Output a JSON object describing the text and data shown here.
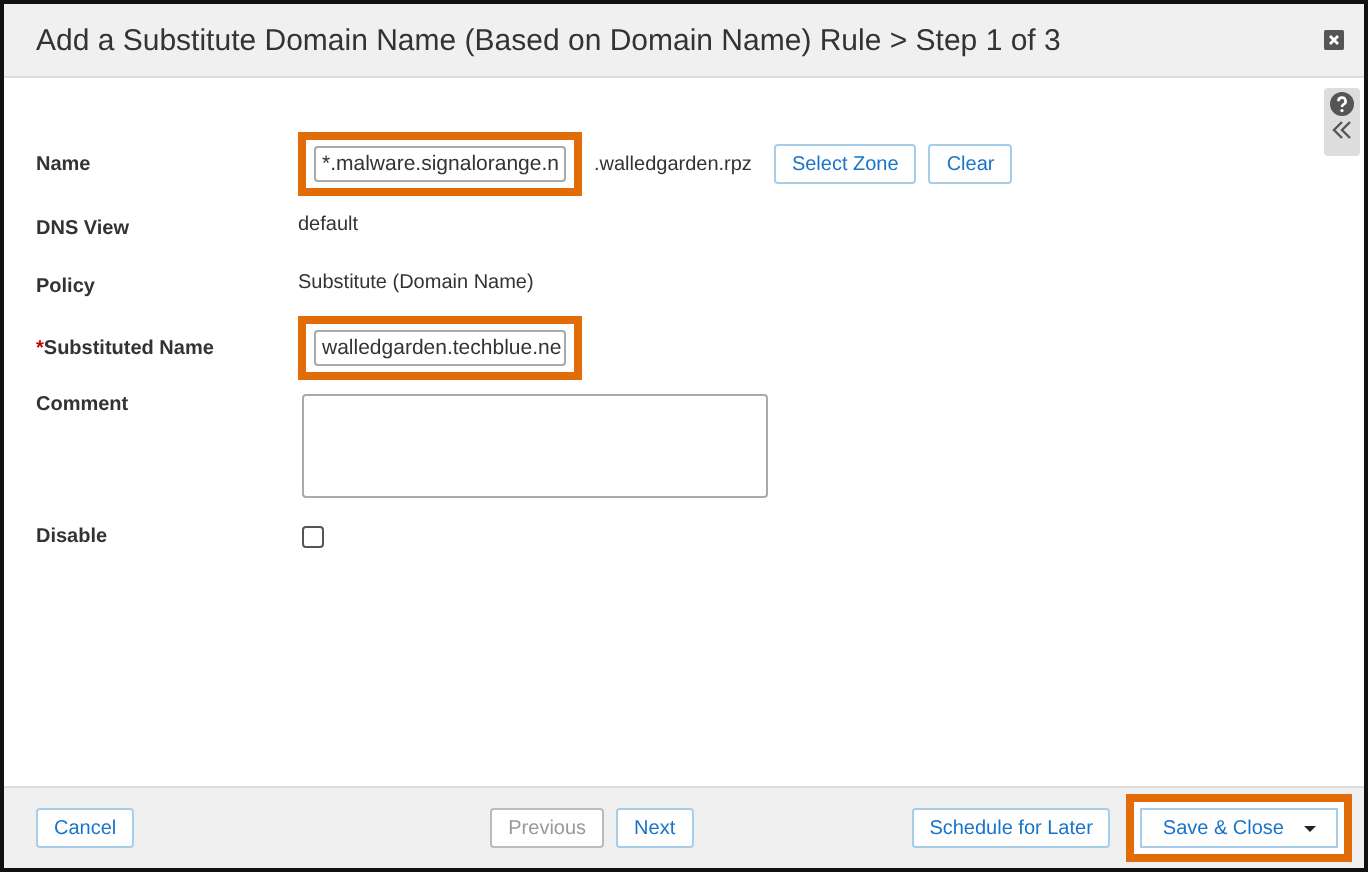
{
  "window": {
    "title": "Add a Substitute Domain Name (Based on Domain Name) Rule > Step 1 of 3"
  },
  "form": [
    {
      "kind": "field",
      "label": "Name",
      "value": "*.malware.signalorange.n",
      "highlighted": true,
      "suffix": ".walledgarden.rpz",
      "buttons": [
        "Select Zone",
        "Clear"
      ]
    },
    {
      "kind": "text",
      "label": "DNS View",
      "text": "default"
    },
    {
      "kind": "text",
      "label": "Policy",
      "text": "Substitute (Domain Name)"
    },
    {
      "kind": "field",
      "required_mark": "*",
      "label": "Substituted Name",
      "value": "walledgarden.techblue.ne",
      "highlighted": true
    },
    {
      "kind": "textarea",
      "label": "Comment"
    },
    {
      "kind": "checkbox",
      "label": "Disable",
      "checked": false
    }
  ],
  "footer": {
    "left": [
      {
        "label": "Cancel",
        "disabled": false,
        "highlighted": false,
        "dropdown": false
      }
    ],
    "center": [
      {
        "label": "Previous",
        "disabled": true,
        "highlighted": false,
        "dropdown": false
      },
      {
        "label": "Next",
        "disabled": false,
        "highlighted": false,
        "dropdown": false
      }
    ],
    "right": [
      {
        "label": "Schedule for Later",
        "disabled": false,
        "highlighted": false,
        "dropdown": false
      },
      {
        "label": "Save & Close",
        "disabled": false,
        "highlighted": true,
        "dropdown": true
      }
    ]
  }
}
